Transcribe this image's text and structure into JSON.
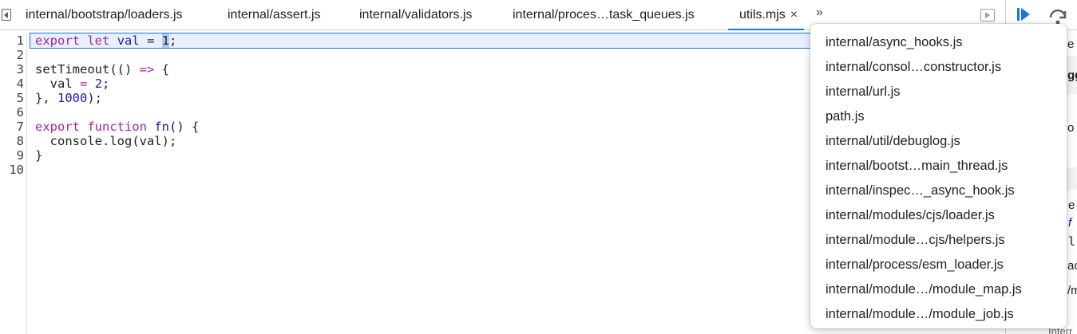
{
  "tabs": [
    {
      "label": "internal/bootstrap/loaders.js",
      "active": false
    },
    {
      "label": "internal/assert.js",
      "active": false
    },
    {
      "label": "internal/validators.js",
      "active": false
    },
    {
      "label": "internal/proces…task_queues.js",
      "active": false
    },
    {
      "label": "utils.mjs",
      "active": true
    }
  ],
  "tab_close_glyph": "×",
  "more_tabs_glyph": "»",
  "editor": {
    "line_numbers": [
      "1",
      "2",
      "3",
      "4",
      "5",
      "6",
      "7",
      "8",
      "9",
      "10"
    ],
    "lines": [
      {
        "segments": [
          {
            "t": "export",
            "c": "kw"
          },
          {
            "t": " "
          },
          {
            "t": "let",
            "c": "kw"
          },
          {
            "t": " "
          },
          {
            "t": "val",
            "c": "var"
          },
          {
            "t": " = "
          },
          {
            "t": "1",
            "c": "sel"
          },
          {
            "t": ";"
          }
        ],
        "current": true
      },
      {
        "segments": [
          {
            "t": ""
          }
        ]
      },
      {
        "segments": [
          {
            "t": "setTimeout(() "
          },
          {
            "t": "=>",
            "c": "kw"
          },
          {
            "t": " {"
          }
        ]
      },
      {
        "segments": [
          {
            "t": "  val "
          },
          {
            "t": "=",
            "c": "kw"
          },
          {
            "t": " "
          },
          {
            "t": "2",
            "c": "num"
          },
          {
            "t": ";"
          }
        ]
      },
      {
        "segments": [
          {
            "t": "}, "
          },
          {
            "t": "1000",
            "c": "num"
          },
          {
            "t": ");"
          }
        ]
      },
      {
        "segments": [
          {
            "t": ""
          }
        ]
      },
      {
        "segments": [
          {
            "t": "export",
            "c": "kw"
          },
          {
            "t": " "
          },
          {
            "t": "function",
            "c": "kw"
          },
          {
            "t": " "
          },
          {
            "t": "fn",
            "c": "fn"
          },
          {
            "t": "() {"
          }
        ]
      },
      {
        "segments": [
          {
            "t": "  console.log(val);"
          }
        ]
      },
      {
        "segments": [
          {
            "t": "}"
          }
        ]
      },
      {
        "segments": [
          {
            "t": ""
          }
        ]
      }
    ]
  },
  "overflow_menu": {
    "items": [
      "internal/async_hooks.js",
      "internal/consol…constructor.js",
      "internal/url.js",
      "path.js",
      "internal/util/debuglog.js",
      "internal/bootst…main_thread.js",
      "internal/inspec…_async_hook.js",
      "internal/modules/cjs/loader.js",
      "internal/module…cjs/helpers.js",
      "internal/process/esm_loader.js",
      "internal/module…/module_map.js",
      "internal/module…/module_job.js"
    ]
  },
  "sidebar_peek": {
    "texts": [
      "e",
      "gg",
      "o",
      "e",
      "f",
      "l",
      "ac",
      "/m",
      "Interr"
    ]
  },
  "colors": {
    "accent": "#1a73e8",
    "keyword": "#a626a4",
    "number": "#1a1aa6",
    "selection": "#aecbfa"
  },
  "icons": {
    "tab_scroll_left": "triangle-left-icon",
    "more_tabs": "double-chevron-right-icon",
    "toggle_navigator": "play-square-icon",
    "resume": "resume-icon",
    "step_over": "step-over-icon"
  }
}
